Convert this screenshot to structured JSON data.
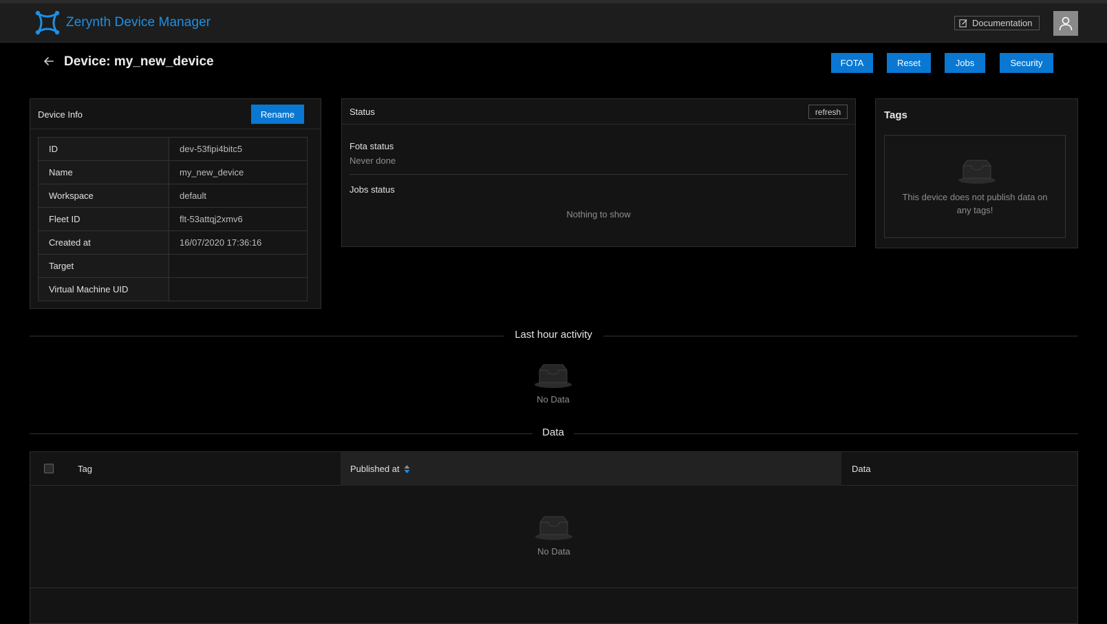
{
  "header": {
    "brand": "Zerynth Device Manager",
    "doc_label": "Documentation"
  },
  "page": {
    "title": "Device: my_new_device",
    "actions": [
      "FOTA",
      "Reset",
      "Jobs",
      "Security"
    ]
  },
  "device_info": {
    "title": "Device Info",
    "rename_label": "Rename",
    "rows": [
      {
        "key": "ID",
        "value": "dev-53fipi4bitc5"
      },
      {
        "key": "Name",
        "value": "my_new_device"
      },
      {
        "key": "Workspace",
        "value": "default"
      },
      {
        "key": "Fleet ID",
        "value": "flt-53attqj2xmv6"
      },
      {
        "key": "Created at",
        "value": "16/07/2020 17:36:16"
      },
      {
        "key": "Target",
        "value": ""
      },
      {
        "key": "Virtual Machine UID",
        "value": ""
      }
    ]
  },
  "status": {
    "title": "Status",
    "refresh_label": "refresh",
    "fota_label": "Fota status",
    "fota_value": "Never done",
    "jobs_label": "Jobs status",
    "jobs_empty": "Nothing to show"
  },
  "tags": {
    "title": "Tags",
    "empty_text": "This device does not publish data on any tags!"
  },
  "activity": {
    "title": "Last hour activity",
    "empty_text": "No Data"
  },
  "data_section": {
    "title": "Data",
    "columns": [
      "Tag",
      "Published at",
      "Data"
    ],
    "empty_text": "No Data"
  },
  "colors": {
    "accent": "#0a78d2",
    "brand": "#1f8fe5",
    "background": "#000000",
    "panel": "#141414"
  }
}
